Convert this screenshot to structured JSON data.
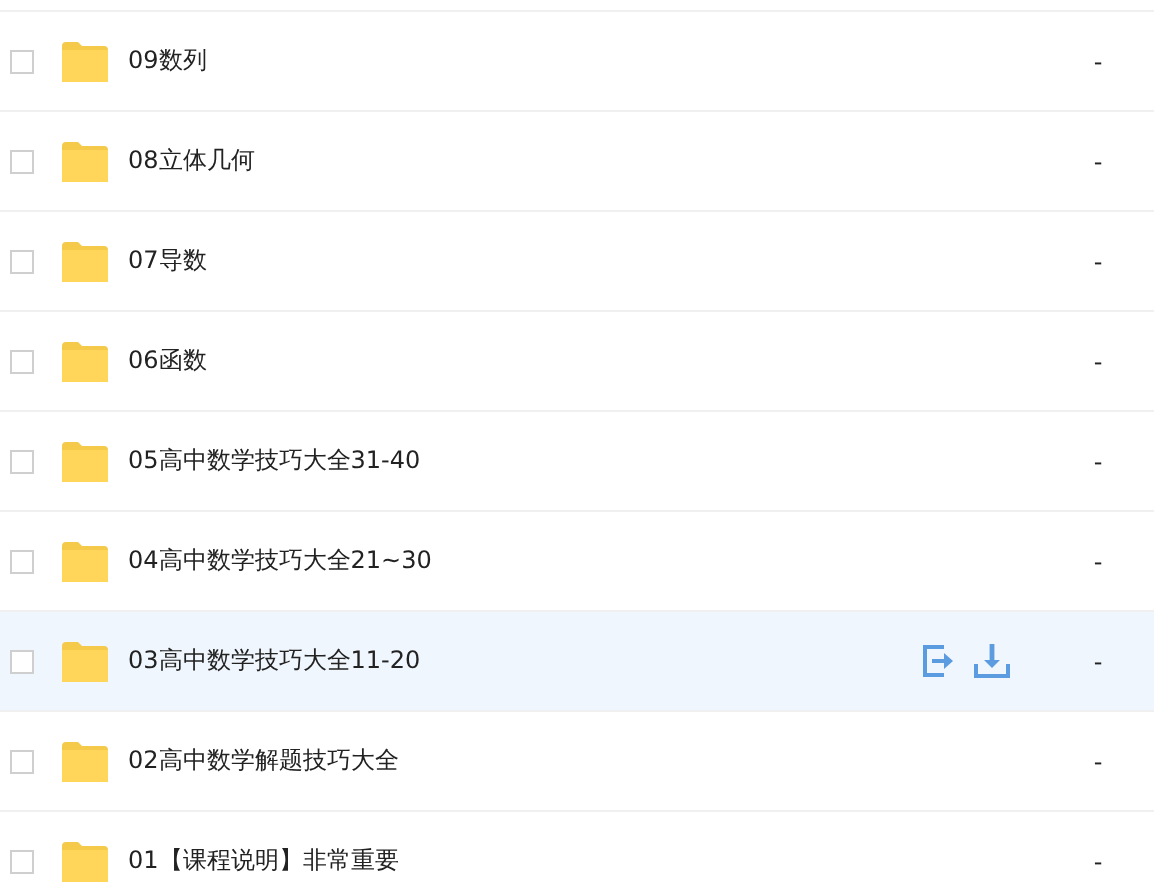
{
  "files": [
    {
      "name": "09数列",
      "size": "-",
      "checked": false,
      "hovered": false
    },
    {
      "name": "08立体几何",
      "size": "-",
      "checked": false,
      "hovered": false
    },
    {
      "name": "07导数",
      "size": "-",
      "checked": false,
      "hovered": false
    },
    {
      "name": "06函数",
      "size": "-",
      "checked": false,
      "hovered": false
    },
    {
      "name": "05高中数学技巧大全31-40",
      "size": "-",
      "checked": false,
      "hovered": false
    },
    {
      "name": "04高中数学技巧大全21~30",
      "size": "-",
      "checked": false,
      "hovered": false
    },
    {
      "name": "03高中数学技巧大全11-20",
      "size": "-",
      "checked": false,
      "hovered": true
    },
    {
      "name": "02高中数学解题技巧大全",
      "size": "-",
      "checked": false,
      "hovered": false
    },
    {
      "name": "01【课程说明】非常重要",
      "size": "-",
      "checked": false,
      "hovered": false
    }
  ]
}
